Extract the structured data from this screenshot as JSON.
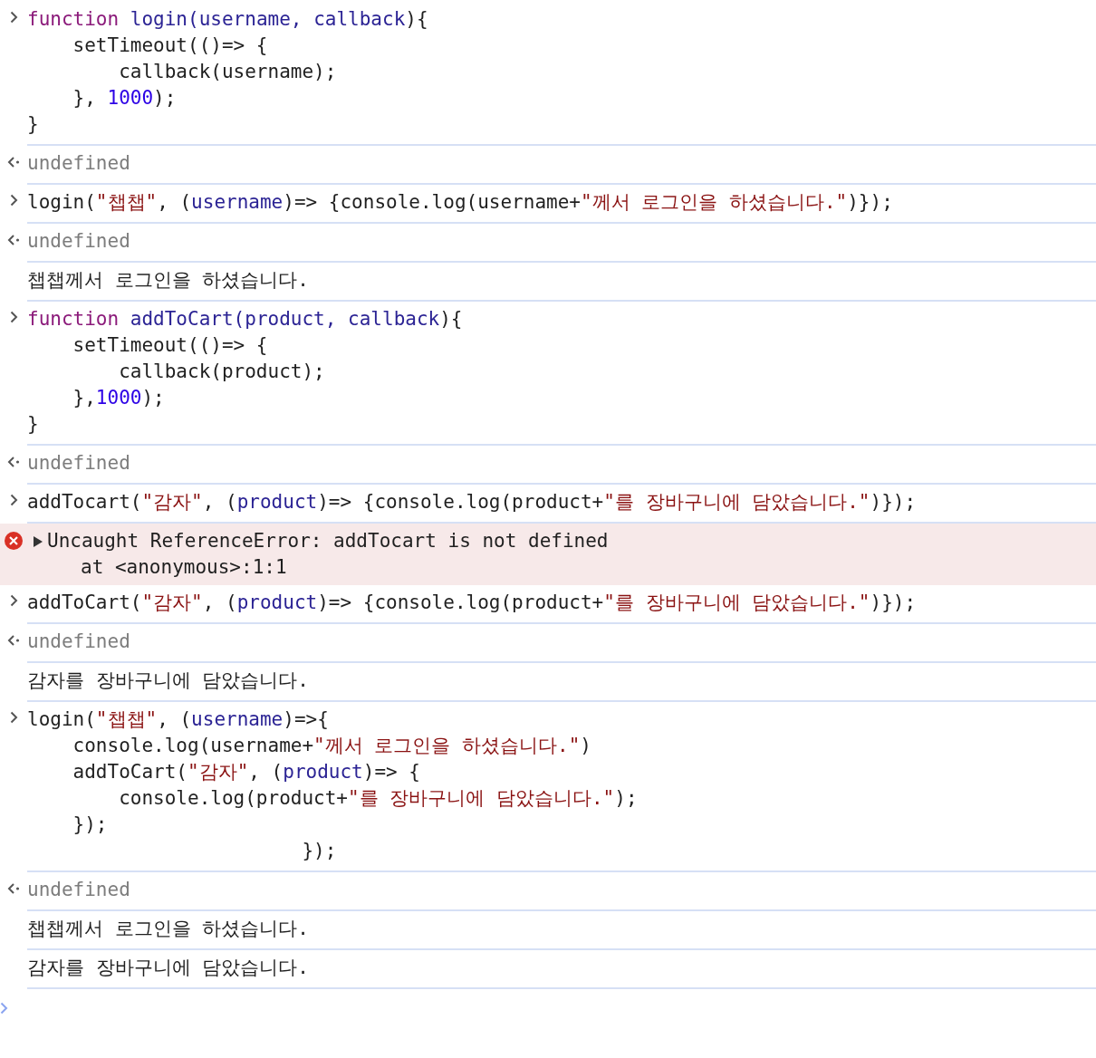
{
  "entries": [
    {
      "kind": "input",
      "lines": [
        [
          {
            "kind": "kw",
            "t": "function"
          },
          {
            "kind": "def",
            "t": " login"
          },
          {
            "kind": "def",
            "t": "("
          },
          {
            "kind": "def",
            "t": "username"
          },
          {
            "kind": "def",
            "t": ", "
          },
          {
            "kind": "def",
            "t": "callback"
          },
          {
            "kind": "p",
            "t": "){"
          }
        ],
        [
          {
            "kind": "p",
            "t": "    setTimeout(()=> {"
          }
        ],
        [
          {
            "kind": "p",
            "t": "        callback(username);"
          }
        ],
        [
          {
            "kind": "p",
            "t": "    }, "
          },
          {
            "kind": "num",
            "t": "1000"
          },
          {
            "kind": "p",
            "t": ");"
          }
        ],
        [
          {
            "kind": "p",
            "t": "}"
          }
        ]
      ]
    },
    {
      "kind": "result",
      "text": "undefined"
    },
    {
      "kind": "input",
      "lines": [
        [
          {
            "kind": "p",
            "t": "login("
          },
          {
            "kind": "str",
            "t": "\"챕챕\""
          },
          {
            "kind": "p",
            "t": ", ("
          },
          {
            "kind": "def",
            "t": "username"
          },
          {
            "kind": "p",
            "t": ")=> {console.log(username+"
          },
          {
            "kind": "str",
            "t": "\"께서 로그인을 하셨습니다.\""
          },
          {
            "kind": "p",
            "t": ")});"
          }
        ]
      ]
    },
    {
      "kind": "result",
      "text": "undefined"
    },
    {
      "kind": "log",
      "text": "챕챕께서 로그인을 하셨습니다."
    },
    {
      "kind": "input",
      "lines": [
        [
          {
            "kind": "kw",
            "t": "function"
          },
          {
            "kind": "def",
            "t": " addToCart"
          },
          {
            "kind": "def",
            "t": "("
          },
          {
            "kind": "def",
            "t": "product"
          },
          {
            "kind": "def",
            "t": ", "
          },
          {
            "kind": "def",
            "t": "callback"
          },
          {
            "kind": "p",
            "t": "){"
          }
        ],
        [
          {
            "kind": "p",
            "t": "    setTimeout(()=> {"
          }
        ],
        [
          {
            "kind": "p",
            "t": "        callback(product);"
          }
        ],
        [
          {
            "kind": "p",
            "t": "    },"
          },
          {
            "kind": "num",
            "t": "1000"
          },
          {
            "kind": "p",
            "t": ");"
          }
        ],
        [
          {
            "kind": "p",
            "t": "}"
          }
        ]
      ]
    },
    {
      "kind": "result",
      "text": "undefined"
    },
    {
      "kind": "input",
      "lines": [
        [
          {
            "kind": "p",
            "t": "addTocart("
          },
          {
            "kind": "str",
            "t": "\"감자\""
          },
          {
            "kind": "p",
            "t": ", ("
          },
          {
            "kind": "def",
            "t": "product"
          },
          {
            "kind": "p",
            "t": ")=> {console.log(product+"
          },
          {
            "kind": "str",
            "t": "\"를 장바구니에 담았습니다.\""
          },
          {
            "kind": "p",
            "t": ")});"
          }
        ]
      ]
    },
    {
      "kind": "error",
      "summary": "Uncaught ReferenceError: addTocart is not defined",
      "stack": "at <anonymous>:1:1",
      "expanded": false
    },
    {
      "kind": "input",
      "lines": [
        [
          {
            "kind": "p",
            "t": "addToCart("
          },
          {
            "kind": "str",
            "t": "\"감자\""
          },
          {
            "kind": "p",
            "t": ", ("
          },
          {
            "kind": "def",
            "t": "product"
          },
          {
            "kind": "p",
            "t": ")=> {console.log(product+"
          },
          {
            "kind": "str",
            "t": "\"를 장바구니에 담았습니다.\""
          },
          {
            "kind": "p",
            "t": ")});"
          }
        ]
      ]
    },
    {
      "kind": "result",
      "text": "undefined"
    },
    {
      "kind": "log",
      "text": "감자를 장바구니에 담았습니다."
    },
    {
      "kind": "input",
      "lines": [
        [
          {
            "kind": "p",
            "t": "login("
          },
          {
            "kind": "str",
            "t": "\"챕챕\""
          },
          {
            "kind": "p",
            "t": ", ("
          },
          {
            "kind": "def",
            "t": "username"
          },
          {
            "kind": "p",
            "t": ")=>{"
          }
        ],
        [
          {
            "kind": "p",
            "t": "    console.log(username+"
          },
          {
            "kind": "str",
            "t": "\"께서 로그인을 하셨습니다.\""
          },
          {
            "kind": "p",
            "t": ")"
          }
        ],
        [
          {
            "kind": "p",
            "t": "    addToCart("
          },
          {
            "kind": "str",
            "t": "\"감자\""
          },
          {
            "kind": "p",
            "t": ", ("
          },
          {
            "kind": "def",
            "t": "product"
          },
          {
            "kind": "p",
            "t": ")=> {"
          }
        ],
        [
          {
            "kind": "p",
            "t": "        console.log(product+"
          },
          {
            "kind": "str",
            "t": "\"를 장바구니에 담았습니다.\""
          },
          {
            "kind": "p",
            "t": ");"
          }
        ],
        [
          {
            "kind": "p",
            "t": "    });"
          }
        ],
        [
          {
            "kind": "p",
            "t": "                        });"
          }
        ]
      ]
    },
    {
      "kind": "result",
      "text": "undefined"
    },
    {
      "kind": "log",
      "text": "챕챕께서 로그인을 하셨습니다."
    },
    {
      "kind": "log",
      "text": "감자를 장바구니에 담았습니다."
    }
  ]
}
